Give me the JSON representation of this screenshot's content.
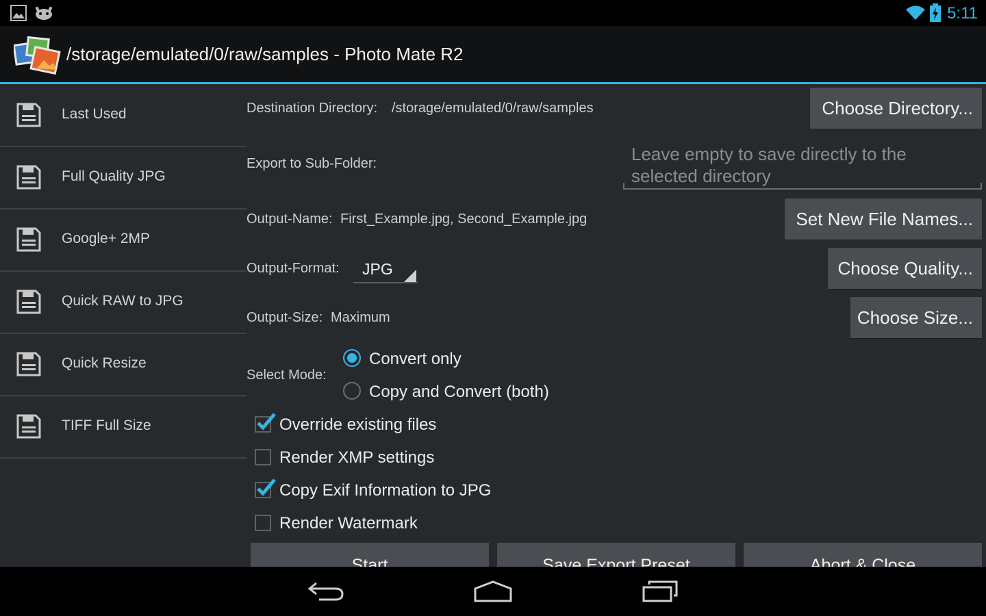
{
  "status_bar": {
    "time": "5:11",
    "icons": [
      "gallery-notification-icon",
      "android-notification-icon",
      "wifi-icon",
      "battery-charging-icon"
    ],
    "accent_color": "#33b5e5"
  },
  "action_bar": {
    "title": "/storage/emulated/0/raw/samples - Photo Mate R2",
    "logo_icon": "photo-mate-logo-icon"
  },
  "sidebar": {
    "items": [
      {
        "label": "Last Used",
        "icon": "save-icon"
      },
      {
        "label": "Full Quality JPG",
        "icon": "save-icon"
      },
      {
        "label": "Google+ 2MP",
        "icon": "save-icon"
      },
      {
        "label": "Quick RAW to JPG",
        "icon": "save-icon"
      },
      {
        "label": "Quick Resize",
        "icon": "save-icon"
      },
      {
        "label": "TIFF Full Size",
        "icon": "save-icon"
      }
    ]
  },
  "form": {
    "destination": {
      "label": "Destination Directory:",
      "value": "/storage/emulated/0/raw/samples",
      "button": "Choose Directory..."
    },
    "subfolder": {
      "label": "Export to Sub-Folder:",
      "placeholder_line1": "Leave empty to save directly to the",
      "placeholder_line2": "selected directory"
    },
    "output_name": {
      "label": "Output-Name:",
      "value": "First_Example.jpg, Second_Example.jpg",
      "button": "Set New File Names..."
    },
    "output_format": {
      "label": "Output-Format:",
      "value": "JPG",
      "button": "Choose Quality..."
    },
    "output_size": {
      "label": "Output-Size:",
      "value": "Maximum",
      "button": "Choose Size..."
    },
    "select_mode": {
      "label": "Select Mode:",
      "options": [
        {
          "label": "Convert only",
          "checked": true
        },
        {
          "label": "Copy and Convert (both)",
          "checked": false
        }
      ]
    },
    "checkboxes": [
      {
        "label": "Override existing files",
        "checked": true
      },
      {
        "label": "Render XMP settings",
        "checked": false
      },
      {
        "label": "Copy Exif Information to JPG",
        "checked": true
      },
      {
        "label": "Render Watermark",
        "checked": false
      }
    ]
  },
  "actions": {
    "start": "Start",
    "save_preset": "Save Export Preset",
    "abort": "Abort & Close"
  },
  "nav_bar": {
    "icons": [
      "back-icon",
      "home-icon",
      "recent-apps-icon"
    ]
  }
}
